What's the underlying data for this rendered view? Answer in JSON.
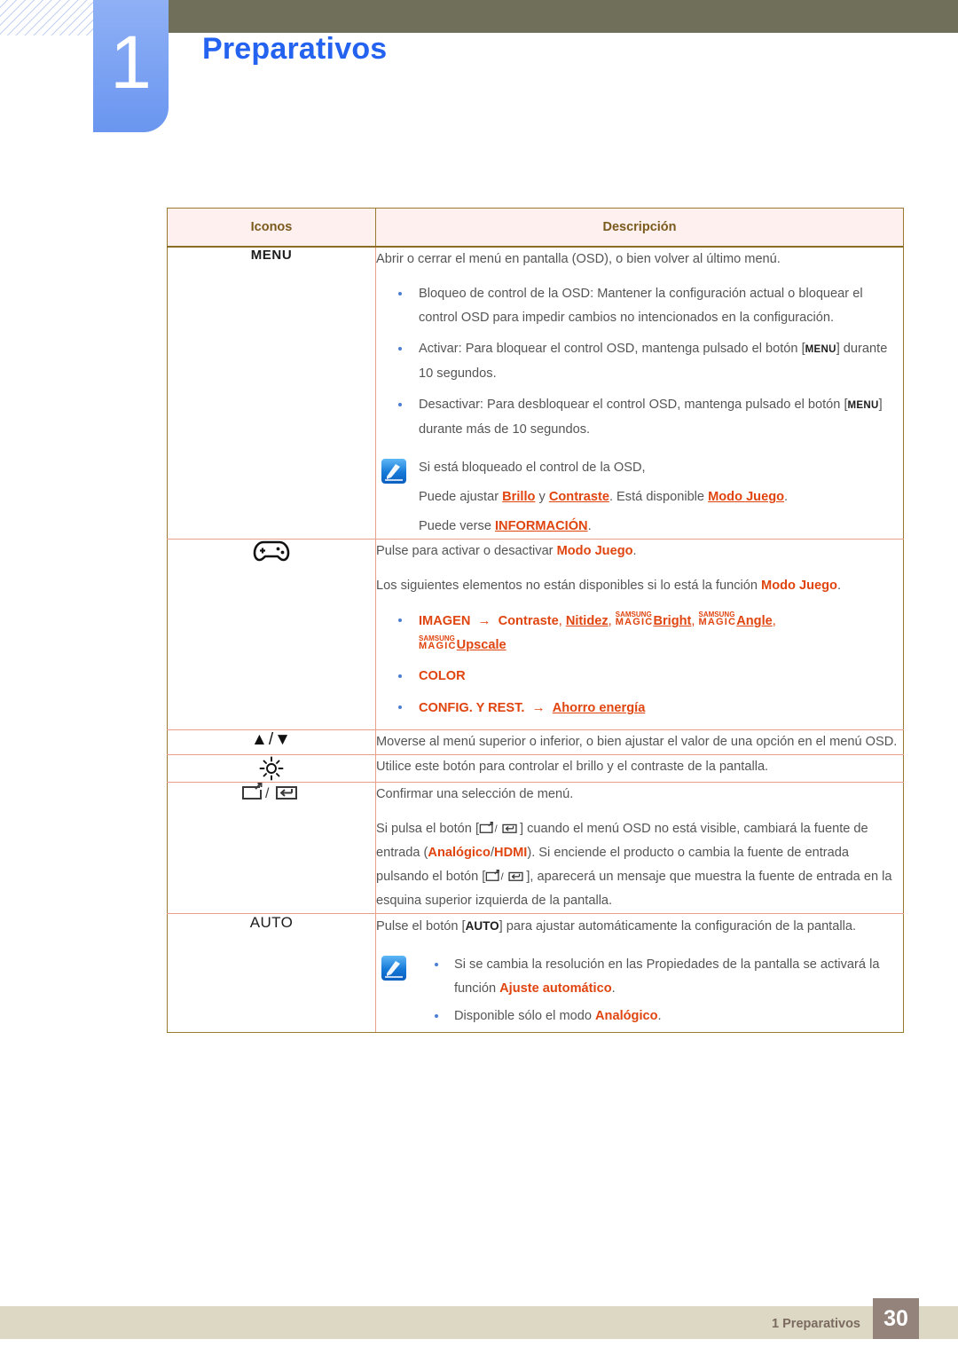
{
  "header": {
    "chapter_number": "1",
    "chapter_title": "Preparativos"
  },
  "table": {
    "columns": [
      "Iconos",
      "Descripción"
    ],
    "rows": [
      {
        "icon_label": "MENU",
        "icon_kind": "menu-text",
        "intro": "Abrir o cerrar el menú en pantalla (OSD), o bien volver al último menú.",
        "bullets": [
          "Bloqueo de control de la OSD: Mantener la configuración actual o bloquear el control OSD para impedir cambios no intencionados en la configuración.",
          "Activar: Para bloquear el control OSD, mantenga pulsado el botón [MENU] durante 10 segundos.",
          "Desactivar: Para desbloquear el control OSD, mantenga pulsado el botón [MENU] durante más de 10 segundos."
        ],
        "note": {
          "line1": "Si está bloqueado el control de la OSD,",
          "line2_prefix": "Puede ajustar ",
          "line2_link1": "Brillo",
          "line2_mid": " y ",
          "line2_link2": "Contraste",
          "line2_mid2": ". Está disponible ",
          "line2_link3": "Modo Juego",
          "line2_suffix": ".",
          "line3_prefix": "Puede verse ",
          "line3_link": "INFORMACIÓN",
          "line3_suffix": "."
        }
      },
      {
        "icon_kind": "gamepad",
        "icon_label": "gamepad-icon",
        "p1_prefix": "Pulse para activar o desactivar ",
        "p1_link": "Modo Juego",
        "p1_suffix": ".",
        "p2_prefix": "Los siguientes elementos no están disponibles si lo está la función ",
        "p2_link": "Modo Juego",
        "p2_suffix": ".",
        "items": {
          "imagen": "IMAGEN",
          "arrow": "→",
          "contraste": "Contraste",
          "nitidez": "Nitidez",
          "magic_top": "SAMSUNG",
          "magic_bottom": "MAGIC",
          "bright": "Bright",
          "angle": "Angle",
          "upscale": "Upscale",
          "color": "COLOR",
          "config": "CONFIG. Y REST.",
          "ahorro": "Ahorro energía"
        }
      },
      {
        "icon_kind": "arrows",
        "icon_label": "▲/▼",
        "text": "Moverse al menú superior o inferior, o bien ajustar el valor de una opción en el menú OSD."
      },
      {
        "icon_kind": "sun",
        "icon_label": "brightness-icon",
        "text": "Utilice este botón para controlar el brillo y el contraste de la pantalla."
      },
      {
        "icon_kind": "source",
        "icon_label": "source-enter-icon",
        "p1": "Confirmar una selección de menú.",
        "p2_a": "Si pulsa el botón [",
        "p2_b": "] cuando el menú OSD no está visible, cambiará la fuente de entrada (",
        "p2_analog": "Analógico",
        "p2_slash": "/",
        "p2_hdmi": "HDMI",
        "p2_c": "). Si enciende el producto o cambia la fuente de entrada pulsando el botón [",
        "p2_d": "], aparecerá un mensaje que muestra la fuente de entrada en la esquina superior izquierda de la pantalla."
      },
      {
        "icon_kind": "auto-text",
        "icon_label": "AUTO",
        "p1_a": "Pulse el botón [",
        "p1_key": "AUTO",
        "p1_b": "] para ajustar automáticamente la configuración de la pantalla.",
        "note_bullets": [
          {
            "prefix": "Si se cambia la resolución en las Propiedades de la pantalla se activará la función ",
            "link": "Ajuste automático",
            "suffix": "."
          },
          {
            "prefix": "Disponible sólo el modo ",
            "link": "Analógico",
            "suffix": "."
          }
        ]
      }
    ]
  },
  "footer": {
    "label": "1 Preparativos",
    "page": "30"
  },
  "colors": {
    "accent_orange": "#e04510",
    "chapter_blue": "#2462f0",
    "tab_blue": "#6a96f0",
    "olive": "#70705a",
    "table_border": "#9a7a2e",
    "row_border": "#e8a08c",
    "header_bg": "#fdf0ee",
    "header_text": "#7a5a1d",
    "footer_bg": "#ddd8c4",
    "footer_page_bg": "#93837a"
  }
}
